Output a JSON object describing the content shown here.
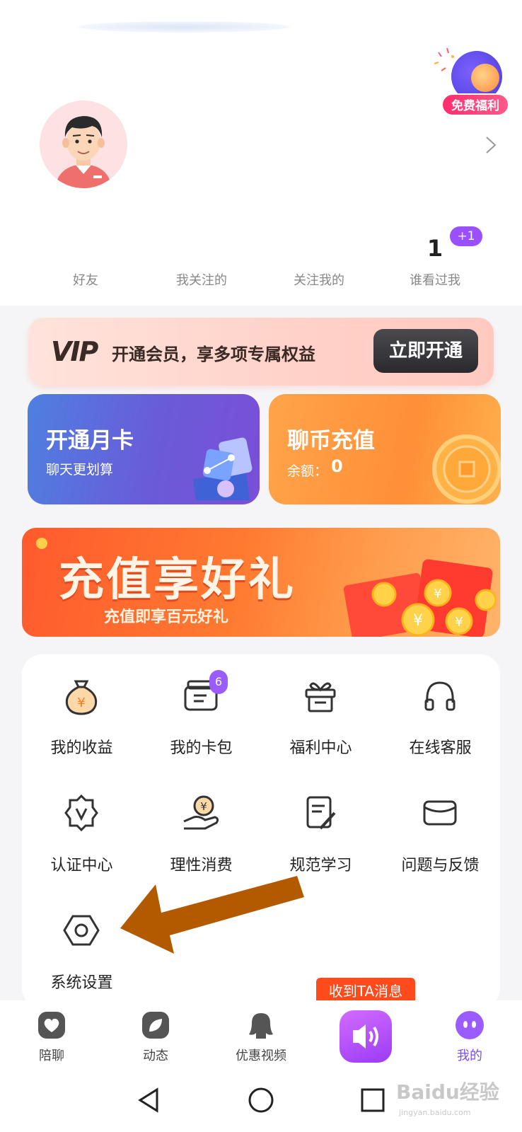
{
  "promo": {
    "label": "免费福利",
    "icon": "megaphone-icon"
  },
  "profile": {
    "chevron": "chevron-right-icon",
    "avatar": "avatar-icon"
  },
  "stats": [
    {
      "label": "好友",
      "count": ""
    },
    {
      "label": "我关注的",
      "count": ""
    },
    {
      "label": "关注我的",
      "count": ""
    },
    {
      "label": "谁看过我",
      "count": "1",
      "badge": "+1"
    }
  ],
  "vip": {
    "logo": "VIP",
    "text": "开通会员，享多项专属权益",
    "button": "立即开通"
  },
  "cards": {
    "month": {
      "title": "开通月卡",
      "subtitle": "聊天更划算"
    },
    "coin": {
      "title": "聊币充值",
      "balance_label": "余额：",
      "balance_value": "0"
    }
  },
  "banner": {
    "title": "充值享好礼",
    "subtitle": "充值即享百元好礼"
  },
  "grid": [
    {
      "label": "我的收益",
      "icon": "money-bag-icon"
    },
    {
      "label": "我的卡包",
      "icon": "card-wallet-icon",
      "badge": "6"
    },
    {
      "label": "福利中心",
      "icon": "gift-icon"
    },
    {
      "label": "在线客服",
      "icon": "headphones-icon"
    },
    {
      "label": "认证中心",
      "icon": "verified-badge-icon"
    },
    {
      "label": "理性消费",
      "icon": "hand-coin-icon"
    },
    {
      "label": "规范学习",
      "icon": "document-edit-icon"
    },
    {
      "label": "问题与反馈",
      "icon": "envelope-icon"
    },
    {
      "label": "系统设置",
      "icon": "settings-hexagon-icon"
    }
  ],
  "toast": "收到TA消息",
  "tabs": [
    {
      "label": "陪聊",
      "icon": "heart-chat-icon"
    },
    {
      "label": "动态",
      "icon": "leaf-icon"
    },
    {
      "label": "优惠视频",
      "icon": "woman-silhouette-icon"
    },
    {
      "label": "",
      "icon": "speaker-icon"
    },
    {
      "label": "我的",
      "icon": "face-icon",
      "active": true
    }
  ],
  "watermark": {
    "text": "Baidu经验",
    "sub": "jingyan.baidu.com"
  },
  "colors": {
    "accent": "#7a4cff",
    "toast": "#ff4a1c",
    "vip_button": "#2a2a2e"
  }
}
